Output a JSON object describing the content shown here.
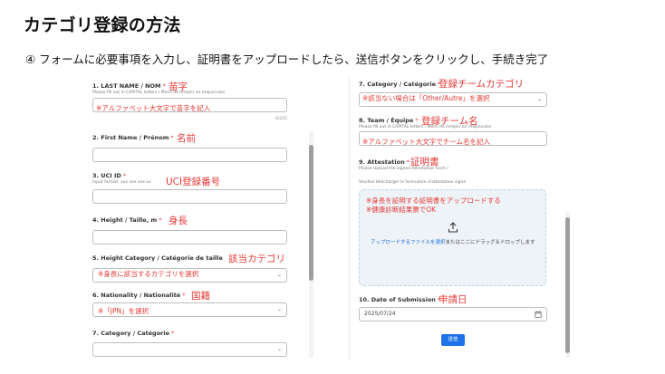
{
  "slide": {
    "title": "カテゴリ登録の方法",
    "step": "④ フォームに必要事項を入力し、証明書をアップロードしたら、送信ボタンをクリックし、手続き完了"
  },
  "left_form": {
    "fields": [
      {
        "label": "1. LAST NAME / NOM",
        "required": "*",
        "help": "Please fill out in CAPITAL letters / Merci de remplir en majuscules",
        "value": "",
        "counter": "0/255"
      },
      {
        "label": "2. First Name / Prénom",
        "required": "*",
        "value": ""
      },
      {
        "label": "3. UCI ID",
        "required": "*",
        "help": "Input format: xxx xxx xxx xx",
        "value": ""
      },
      {
        "label": "4. Height / Taille, m",
        "required": "*",
        "value": ""
      },
      {
        "label": "5. Height Category / Catégorie de taille",
        "required": "",
        "value": ""
      },
      {
        "label": "6. Nationality / Nationalité",
        "required": "*",
        "value": ""
      },
      {
        "label": "7. Category / Catégorie",
        "required": "*",
        "value": ""
      }
    ]
  },
  "right_form": {
    "fields": [
      {
        "label": "7. Category / Catégorie",
        "required": "*",
        "value": ""
      },
      {
        "label": "8. Team / Équipe",
        "required": "*",
        "help": "Please fill out in CAPITAL letters / Merci de remplir en majuscules",
        "value": ""
      },
      {
        "label": "9. Attestation",
        "required": "*",
        "help": "Please Upload the signed Attestation Form /",
        "help2": "Veuillez télécharger le formulaire d'attestation signé"
      },
      {
        "label": "10. Date of Submission",
        "required": "*",
        "value": "2025/07/24"
      }
    ],
    "upload_link": "アップロードするファイルを選択",
    "upload_rest": "またはここにドラッグ＆ドロップします",
    "submit_label": "送信"
  },
  "annotations": {
    "last_name": "苗字",
    "last_name_box": "※アルファベット大文字で苗字を記入",
    "first_name": "名前",
    "uci": "UCI登録番号",
    "height": "身長",
    "height_cat": "該当カテゴリ",
    "height_cat_box": "※身長に該当するカテゴリを選択",
    "nationality": "国籍",
    "nationality_box": "※「JPN」を選択",
    "category": "登録チームカテゴリ",
    "category_box": "※該当ない場合は「Other/Autre」を選択",
    "team": "登録チーム名",
    "team_box": "※アルファベット大文字でチーム名を記入",
    "attestation": "証明書",
    "attestation_box1": "※身長を証明する証明書をアップロードする",
    "attestation_box2": "※健康診断結果票でOK",
    "date": "申請日"
  },
  "colors": {
    "annotation": "#e53935",
    "submit": "#1e73e8",
    "upload_bg": "#eef3f8"
  },
  "icons": {
    "upload": "upload-icon",
    "calendar": "calendar-icon",
    "chevron": "chevron-down-icon"
  }
}
